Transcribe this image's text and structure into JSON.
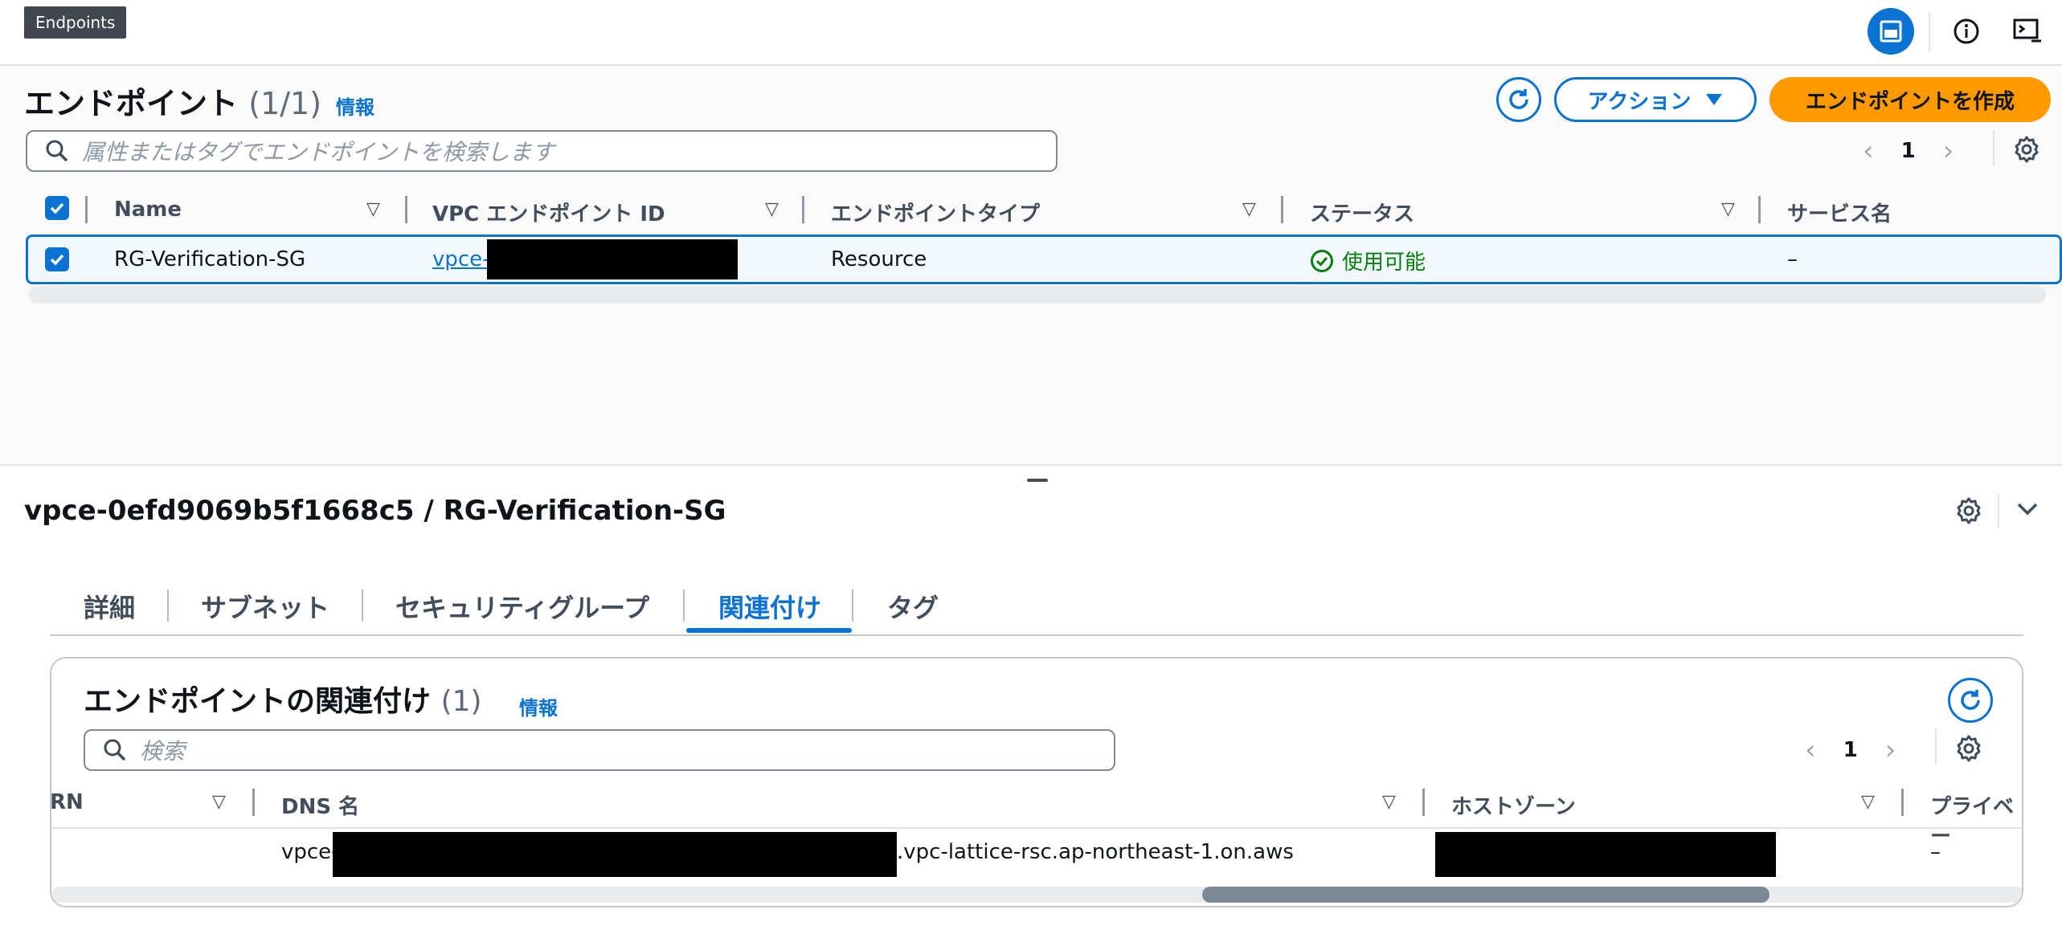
{
  "tooltip": "Endpoints",
  "top_icons": [
    "panel-layout-icon",
    "info-circle-icon",
    "cloudshell-icon"
  ],
  "list": {
    "title": "エンドポイント",
    "count": "(1/1)",
    "info": "情報",
    "search_placeholder": "属性またはタグでエンドポイントを検索します",
    "actions_label": "アクション",
    "create_label": "エンドポイントを作成",
    "page": "1",
    "columns": [
      "Name",
      "VPC エンドポイント ID",
      "エンドポイントタイプ",
      "ステータス",
      "サービス名"
    ],
    "rows": [
      {
        "name": "RG-Verification-SG",
        "vpce_prefix": "vpce-",
        "type": "Resource",
        "status": "使用可能",
        "service": "–"
      }
    ]
  },
  "detail": {
    "title": "vpce-0efd9069b5f1668c5 / RG-Verification-SG",
    "tabs": [
      "詳細",
      "サブネット",
      "セキュリティグループ",
      "関連付け",
      "タグ"
    ],
    "active_tab": "関連付け",
    "assoc": {
      "title": "エンドポイントの関連付け",
      "count": "(1)",
      "info": "情報",
      "search_placeholder": "検索",
      "page": "1",
      "columns": [
        "RN",
        "DNS 名",
        "ホストゾーン",
        "プライベー"
      ],
      "rows": [
        {
          "dns_prefix": "vpce-",
          "dns_suffix": ".vpc-lattice-rsc.ap-northeast-1.on.aws",
          "private": "–"
        }
      ]
    }
  },
  "colors": {
    "accent": "#0972d3",
    "primary_button": "#ff9900",
    "success": "#037f0c"
  }
}
